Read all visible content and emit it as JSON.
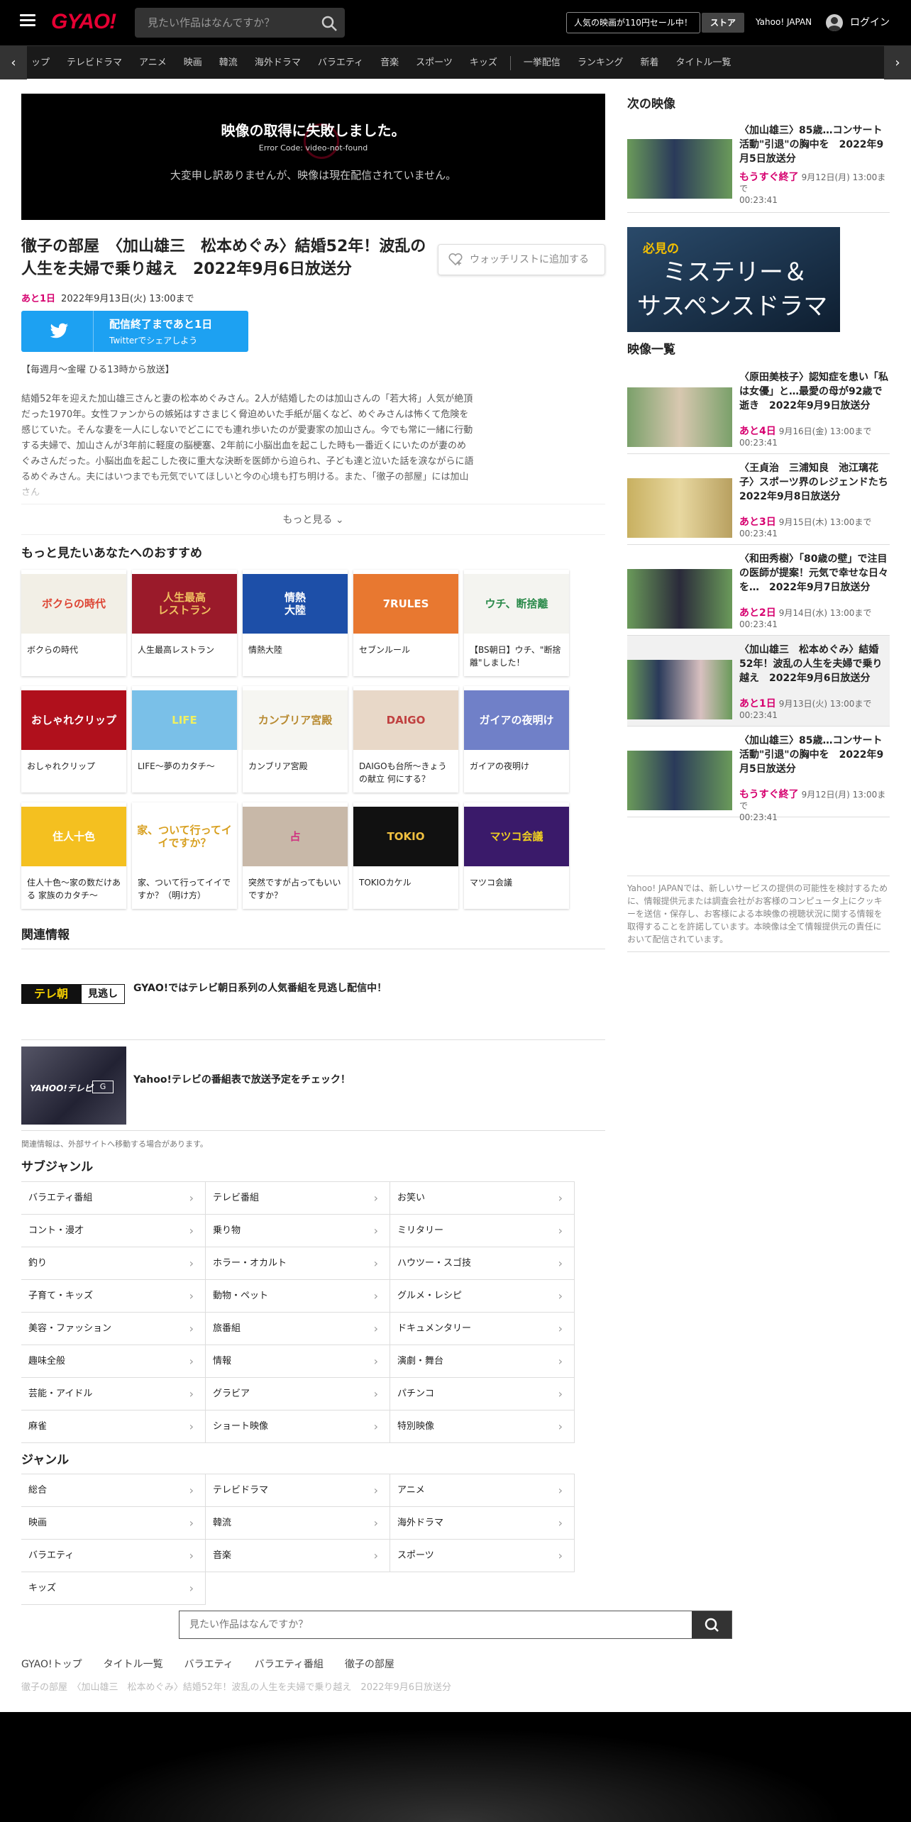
{
  "header": {
    "logo": "GYAO!",
    "search_placeholder": "見たい作品はなんですか？",
    "promo": "人気の映画が110円セール中！",
    "store": "ストア",
    "yahoo_japan": "Yahoo! JAPAN",
    "login": "ログイン"
  },
  "nav": {
    "items": [
      "ップ",
      "テレビドラマ",
      "アニメ",
      "映画",
      "韓流",
      "海外ドラマ",
      "バラエティ",
      "音楽",
      "スポーツ",
      "キッズ",
      "一挙配信",
      "ランキング",
      "新着",
      "タイトル一覧"
    ]
  },
  "player": {
    "error_title": "映像の取得に失敗しました。",
    "error_code": "Error Code: video-not-found",
    "error_message": "大変申し訳ありませんが、映像は現在配信されていません。"
  },
  "program": {
    "title": "徹子の部屋　〈加山雄三　松本めぐみ〉結婚52年！波乱の人生を夫婦で乗り越え　2022年9月6日放送分",
    "watchlist": "ウォッチリストに追加する",
    "remaining_days": "あと1日",
    "end_date": "2022年9月13日(火) 13:00まで",
    "twitter_line1": "配信終了まであと1日",
    "twitter_line2": "Twitterでシェアしよう",
    "schedule": "【毎週月～金曜 ひる13時から放送】",
    "description": "結婚52年を迎えた加山雄三さんと妻の松本めぐみさん。2人が結婚したのは加山さんの「若大将」人気が絶頂だった1970年。女性ファンからの嫉妬はすさまじく脅迫めいた手紙が届くなど、めぐみさんは怖くて危険を感じていた。そんな妻を一人にしないでどこにでも連れ歩いたのが愛妻家の加山さん。今でも常に一緒に行動する夫婦で、加山さんが3年前に軽度の脳梗塞、2年前に小脳出血を起こした時も一番近くにいたのが妻のめぐみさんだった。小脳出血を起こした夜に重大な決断を医師から迫られ、子ども達と泣いた話を涙ながらに語るめぐみさん。夫にはいつまでも元気でいてほしいと今の心境も打ち明ける。また、「徹子の部屋」には加山さん",
    "more": "もっと見る"
  },
  "recommend": {
    "heading": "もっと見たいあなたへのおすすめ",
    "items": [
      {
        "label": "ボクらの時代",
        "color": "#f2efe6",
        "accent": "#d43",
        "text": "ボクらの時代"
      },
      {
        "label": "人生最高レストラン",
        "color": "#9a1a2a",
        "accent": "#f0c060",
        "text": "人生最高\nレストラン"
      },
      {
        "label": "情熱大陸",
        "color": "#1d4fa8",
        "accent": "#ffffff",
        "text": "情熱\n大陸"
      },
      {
        "label": "セブンルール",
        "color": "#e87830",
        "accent": "#ffffff",
        "text": "7RULES"
      },
      {
        "label": "【BS朝日】ウチ、\"断捨離\"しました！",
        "color": "#f4f4f0",
        "accent": "#2a8a4a",
        "text": "ウチ、断捨離"
      },
      {
        "label": "おしゃれクリップ",
        "color": "#b0101c",
        "accent": "#ffffff",
        "text": "おしゃれクリップ"
      },
      {
        "label": "LIFE～夢のカタチ～",
        "color": "#7ac0e8",
        "accent": "#f0f060",
        "text": "LIFE"
      },
      {
        "label": "カンブリア宮殿",
        "color": "#f6f6f2",
        "accent": "#b88a30",
        "text": "カンブリア宮殿"
      },
      {
        "label": "DAIGOも台所～きょうの献立 何にする？",
        "color": "#e8d8c8",
        "accent": "#c04040",
        "text": "DAIGO"
      },
      {
        "label": "ガイアの夜明け",
        "color": "#7080c8",
        "accent": "#ffffff",
        "text": "ガイアの夜明け"
      },
      {
        "label": "住人十色～家の数だけある 家族のカタチ～",
        "color": "#f4c020",
        "accent": "#ffffff",
        "text": "住人十色"
      },
      {
        "label": "家、ついて行ってイイですか？（明け方）",
        "color": "#ffffff",
        "accent": "#d8a020",
        "text": "家、ついて行ってイイですか？"
      },
      {
        "label": "突然ですが占ってもいいですか？",
        "color": "#c8b8a8",
        "accent": "#d03080",
        "text": "占"
      },
      {
        "label": "TOKIOカケル",
        "color": "#111111",
        "accent": "#f0c040",
        "text": "TOKIO"
      },
      {
        "label": "マツコ会議",
        "color": "#3a1a6a",
        "accent": "#f0d020",
        "text": "マツコ会議"
      }
    ]
  },
  "related": {
    "heading": "関連情報",
    "items": [
      {
        "text": "GYAO!ではテレビ朝日系列の人気番組を見逃し配信中！",
        "logo": "テレ朝",
        "logo2": "見逃し"
      },
      {
        "text": "Yahoo!テレビの番組表で放送予定をチェック！",
        "logo": "YAHOO!テレビ",
        "logo2": "G"
      }
    ],
    "note": "関連情報は、外部サイトへ移動する場合があります。"
  },
  "subgenre": {
    "heading": "サブジャンル",
    "items": [
      "バラエティ番組",
      "テレビ番組",
      "お笑い",
      "コント・漫才",
      "乗り物",
      "ミリタリー",
      "釣り",
      "ホラー・オカルト",
      "ハウツー・スゴ技",
      "子育て・キッズ",
      "動物・ペット",
      "グルメ・レシピ",
      "美容・ファッション",
      "旅番組",
      "ドキュメンタリー",
      "趣味全般",
      "情報",
      "演劇・舞台",
      "芸能・アイドル",
      "グラビア",
      "パチンコ",
      "麻雀",
      "ショート映像",
      "特別映像"
    ]
  },
  "genre": {
    "heading": "ジャンル",
    "items": [
      "総合",
      "テレビドラマ",
      "アニメ",
      "映画",
      "韓流",
      "海外ドラマ",
      "バラエティ",
      "音楽",
      "スポーツ",
      "キッズ"
    ]
  },
  "bottom": {
    "search_placeholder": "見たい作品はなんですか？",
    "breadcrumbs": [
      "GYAO!トップ",
      "タイトル一覧",
      "バラエティ",
      "バラエティ番組",
      "徹子の部屋"
    ],
    "current": "徹子の部屋　〈加山雄三　松本めぐみ〉結婚52年！波乱の人生を夫婦で乗り越え　2022年9月6日放送分"
  },
  "sidebar": {
    "next_heading": "次の映像",
    "next": {
      "title": "〈加山雄三〉85歳…コンサート活動\"引退\"の胸中を　2022年9月5日放送分",
      "remain": "もうすぐ終了",
      "date": "9月12日(月) 13:00まで",
      "duration": "00:23:41"
    },
    "banner_line1": "必見の",
    "banner_line2": "ミステリー＆",
    "banner_line3": "サスペンスドラマ",
    "list_heading": "映像一覧",
    "list": [
      {
        "title": "〈原田美枝子〉認知症を患い「私は女優」と…最愛の母が92歳で逝き　2022年9月9日放送分",
        "remain": "あと4日",
        "date": "9月16日(金) 13:00まで",
        "duration": "00:23:41",
        "active": false
      },
      {
        "title": "〈王貞治　三浦知良　池江璃花子〉スポーツ界のレジェンドたち　2022年9月8日放送分",
        "remain": "あと3日",
        "date": "9月15日(木) 13:00まで",
        "duration": "00:23:41",
        "active": false
      },
      {
        "title": "〈和田秀樹〉「80歳の壁」で注目の医師が提案！元気で幸せな日々を…　2022年9月7日放送分",
        "remain": "あと2日",
        "date": "9月14日(水) 13:00まで",
        "duration": "00:23:41",
        "active": false
      },
      {
        "title": "〈加山雄三　松本めぐみ〉結婚52年！波乱の人生を夫婦で乗り越え　2022年9月6日放送分",
        "remain": "あと1日",
        "date": "9月13日(火) 13:00まで",
        "duration": "00:23:41",
        "active": true
      },
      {
        "title": "〈加山雄三〉85歳…コンサート活動\"引退\"の胸中を　2022年9月5日放送分",
        "remain": "もうすぐ終了",
        "date": "9月12日(月) 13:00まで",
        "duration": "00:23:41",
        "active": false
      }
    ],
    "disclaimer": "Yahoo! JAPANでは、新しいサービスの提供の可能性を検討するために、情報提供元または調査会社がお客様のコンピュータ上にクッキーを送信・保存し、お客様による本映像の視聴状況に関する情報を取得することを許諾しています。本映像は全て情報提供元の責任において配信されています。"
  },
  "colors": {
    "accent": "#e60033",
    "remain": "#d6006f",
    "twitter": "#1da1f2"
  }
}
